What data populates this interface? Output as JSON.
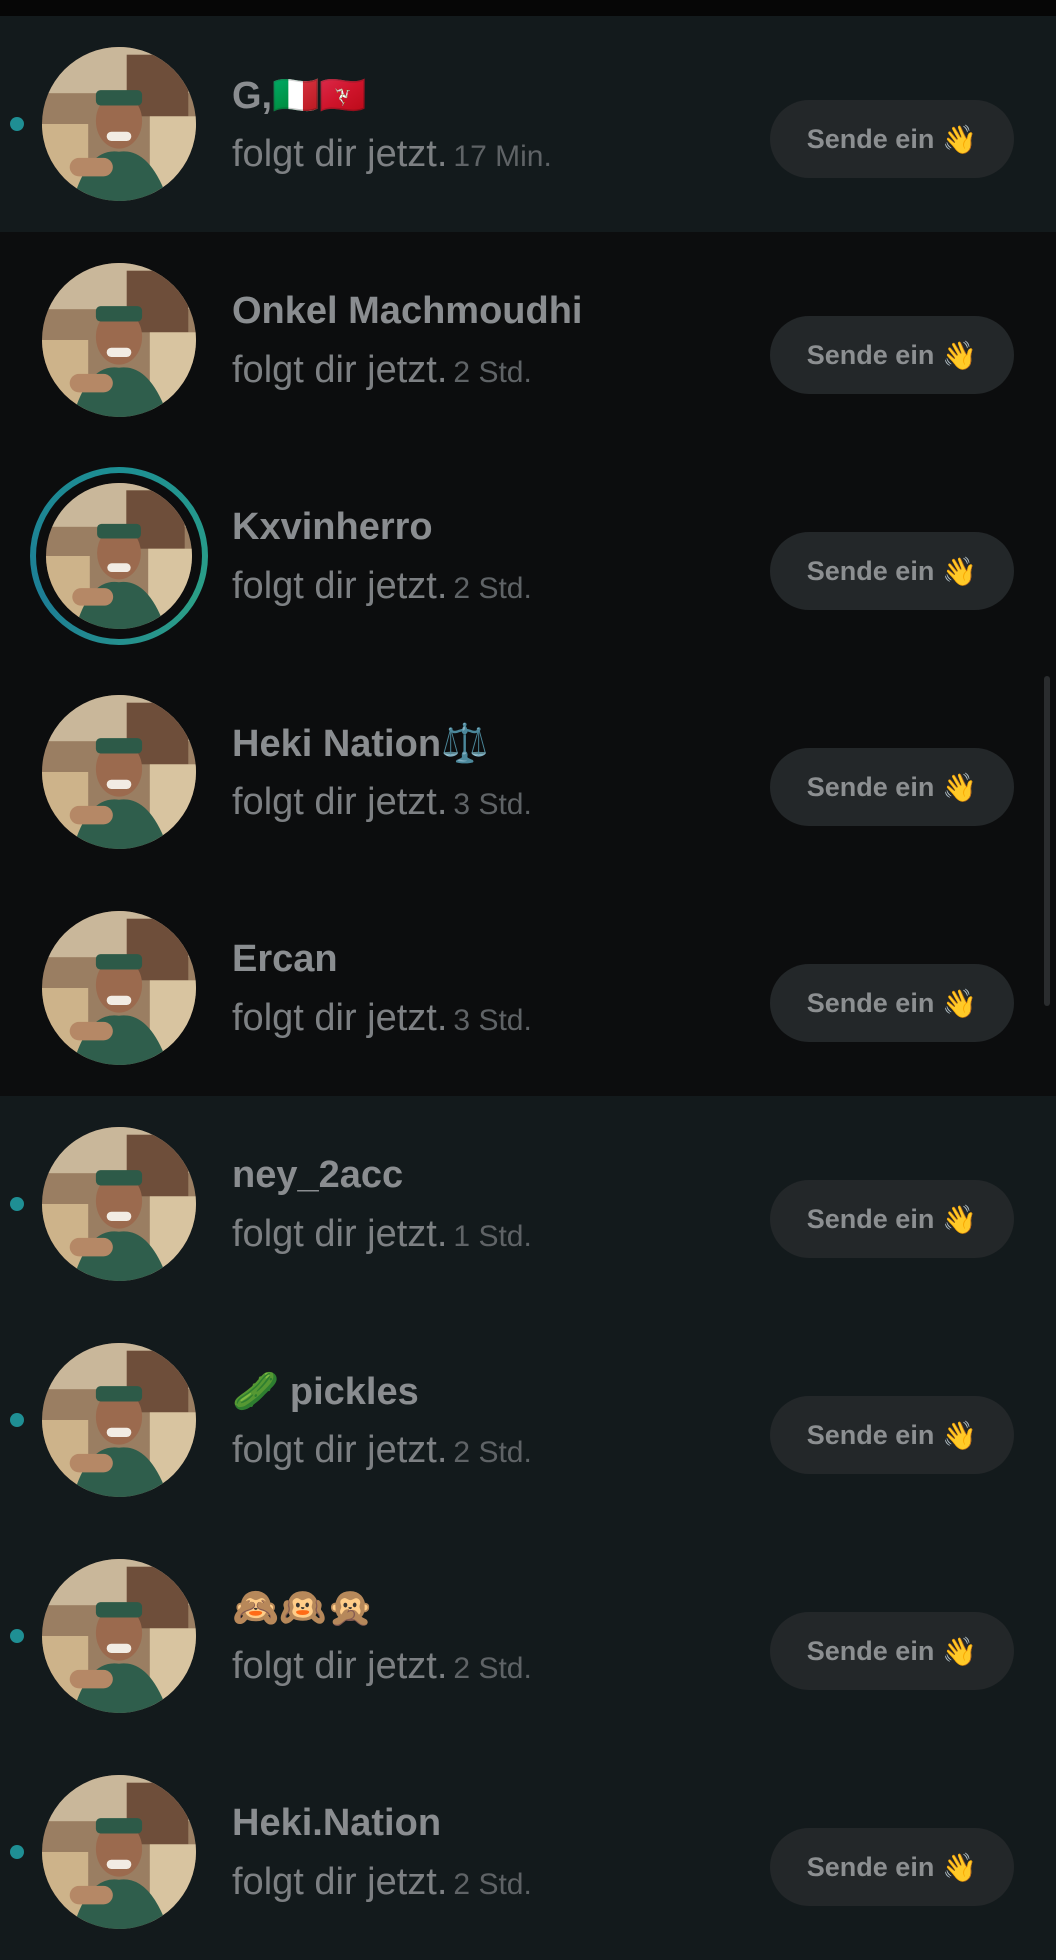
{
  "notifications": [
    {
      "name": "G,🇮🇹🇮🇲",
      "text": "folgt dir jetzt.",
      "time": "17 Min.",
      "button": "Sende ein",
      "unread": true,
      "story": false
    },
    {
      "name": "Onkel Machmoudhi",
      "text": "folgt dir jetzt.",
      "time": "2 Std.",
      "button": "Sende ein",
      "unread": false,
      "story": false
    },
    {
      "name": "Kxvinherro",
      "text": "folgt dir jetzt.",
      "time": "2 Std.",
      "button": "Sende ein",
      "unread": false,
      "story": true
    },
    {
      "name": "Heki Nation⚖️",
      "text": "folgt dir jetzt.",
      "time": "3 Std.",
      "button": "Sende ein",
      "unread": false,
      "story": false
    },
    {
      "name": "Ercan",
      "text": "folgt dir jetzt.",
      "time": "3 Std.",
      "button": "Sende ein",
      "unread": false,
      "story": false
    },
    {
      "name": "ney_2acc",
      "text": "folgt dir jetzt.",
      "time": "1 Std.",
      "button": "Sende ein",
      "unread": true,
      "story": false
    },
    {
      "name": "🥒 pickles",
      "text": "folgt dir jetzt.",
      "time": "2 Std.",
      "button": "Sende ein",
      "unread": true,
      "story": false
    },
    {
      "name": "🙈🙉🙊",
      "text": "folgt dir jetzt.",
      "time": "2 Std.",
      "button": "Sende ein",
      "unread": true,
      "story": false
    },
    {
      "name": "Heki.Nation",
      "text": "folgt dir jetzt.",
      "time": "2 Std.",
      "button": "Sende ein",
      "unread": true,
      "story": false
    }
  ],
  "icons": {
    "button_icon": "waving-hand-icon",
    "unread_indicator": "unread-dot-icon"
  },
  "colors": {
    "unread_bg": "#131a1c",
    "read_bg": "#0c0d0e",
    "accent": "#1f8f94"
  }
}
